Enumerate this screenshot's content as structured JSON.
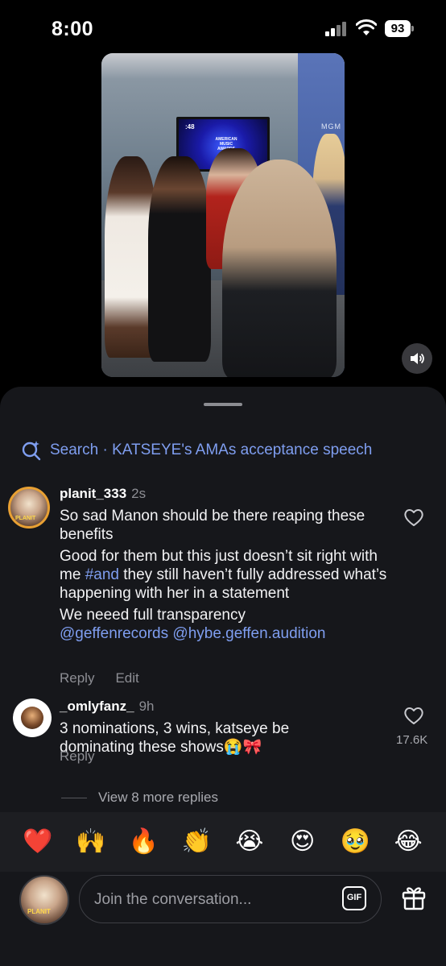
{
  "status_bar": {
    "time": "8:00",
    "battery": "93"
  },
  "video": {
    "tv_timer": ":48",
    "tv_logo_text": "AMERICAN MUSIC AWARDS",
    "banner_text": "MGM"
  },
  "search": {
    "prefix": "Search",
    "separator": "·",
    "query": "KATSEYE's AMAs acceptance speech"
  },
  "comments": [
    {
      "username": "planit_333",
      "time": "2s",
      "paragraphs": {
        "p1": "So sad Manon should be there reaping these benefits",
        "p2_before": "Good for them but this just doesn’t sit right with me ",
        "p2_hashtag": "#and",
        "p2_after": " they still haven’t fully addressed what’s happening with her in a statement",
        "p3": "We neeed full transparency",
        "mentions": "@geffenrecords @hybe.geffen.audition"
      },
      "reply_label": "Reply",
      "edit_label": "Edit"
    },
    {
      "username": "_omlyfanz_",
      "time": "9h",
      "text": "3 nominations, 3 wins, katseye be dominating these shows😭🎀",
      "reply_label": "Reply",
      "likes": "17.6K"
    }
  ],
  "more_replies": "View 8 more replies",
  "emoji_bar": [
    "❤️",
    "🙌",
    "🔥",
    "👏",
    "😭",
    "😍",
    "🥹",
    "😂"
  ],
  "composer": {
    "placeholder": "Join the conversation...",
    "gif_label": "GIF"
  },
  "colors": {
    "accent_link": "#7f9ef0",
    "sheet_bg": "#16171b",
    "emoji_bar_bg": "#1d1e22"
  },
  "icons": [
    "search-sparkle-icon",
    "heart-icon",
    "sound-icon",
    "gif-icon",
    "gift-icon",
    "signal-icon",
    "wifi-icon",
    "battery-icon"
  ]
}
